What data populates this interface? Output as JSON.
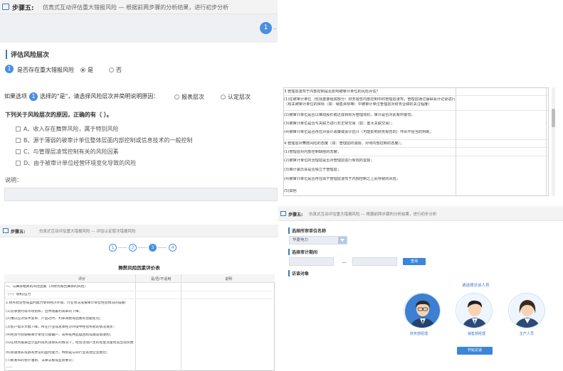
{
  "panelA": {
    "step_label": "步骤五:",
    "header_text": "仿真式互动评估重大错报风险 — 根据前两步骤的分析结果，进行初步分析",
    "current_step": "1",
    "step_more": "...",
    "section_title": "评估风险层次",
    "q1_num": "1",
    "q1_text": "是否存在重大错报风险",
    "q1_opt_yes": "是",
    "q1_opt_no": "否",
    "q2_prefix": "如果选项",
    "q2_num": "1",
    "q2_text": "选择的\"是\"，请选择风险层次并简明说明原因：",
    "q2_opt1": "报表层次",
    "q2_opt2": "认定层次",
    "mc_question": "下列关于风险层次的原因，正确的有（ ）。",
    "choices": [
      "A、收入存在舞弊风险，属于特别风险",
      "B、源于薄弱的被审计单位整体层面内部控制或信息技术的一般控制",
      "C、与管理层凌驾控制有关的风险因素",
      "D、由于被审计单位经营环境变化导致的风险"
    ],
    "explain_label": "说明："
  },
  "panelB": {
    "rows": [
      "3.管理层凌驾于内部控制是否影响被审计单位的风险评估？",
      "(1)在被审计单位（包括重要组成部分）财务报告内部控制中的管理层凌驾，管理层通过操纵会计记录进行舞弊；",
      "（有关被审计单位的目标（如：销售目标等）中被审计单位管理层对财务业绩的关注程度）",
      "(2)被审计单位是否以推动股价或达成目标为管理动机，审计是否对此有所警觉；",
      "(3)被审计单位是否与关联方进行非正常交易（如：重大关联交易）；",
      "(4)被审计单位是否存在对会计政策或会计估计（可能影响财务报告的）作出不恰当的判断；",
      "4.管理层对舞弊风险的态度（如：管理层的诚信、对待内部控制的态度）；",
      "(1)管理层对内部控制缺陷的态度；",
      "(2)被审计单位的治理层是否对管理层进行有效的监督；",
      "(3)审计委员会是否独立于管理层；",
      "(4)被审计单位是否存在由于管理层凌驾于内部控制之上而导致的风险；",
      "(5)其他"
    ]
  },
  "panelC": {
    "step_label": "步骤五:",
    "header_text": "仿真式互动评估重大错报风险 — 评估认定层次错报风险",
    "steps": [
      "1",
      "2",
      "3",
      "4"
    ],
    "active_step": "3",
    "table_title": "舞弊风险因素评价表",
    "col_headers": [
      "评价",
      "是/否/不适用",
      "说明"
    ],
    "rows": [
      "一、与舞弊相关的风险因素（对财务报告舞弊的风险）",
      "（一）动机/压力",
      "1.财务稳定性或盈利能力受到经济环境、行业状况或被审计单位经营情况的威胁：",
      "(1)竞争激烈或市场饱和，且伴随着利润率的下降；",
      "(2)难以应对技术变革、产品过时、利率调整等因素的急剧变化；",
      "(3)客户需求大幅下降，所在行业或总体经济环境中经营失败的情况增多；",
      "(4)经营亏损使被审计单位可能破产、丧失抵押品赎回权或遭恶意收购；",
      "(5)在财务报表显示盈利或利润增长的情况下，经营活动产生的现金流量经常出现负数；",
      "(6)高速增长或具有异常的盈利能力，特别是与同行业其他企业相比；",
      "(7)新发布的会计准则、法律法规或监管要求；",
      "……"
    ]
  },
  "panelD": {
    "step_label": "步骤五:",
    "header_text": "仿真式互动评估重大错报风险 — 根据前两步骤的分析结果，进行初步分析",
    "label_company": "选择所审单位名称",
    "company_value": "华夏电力",
    "label_period": "选择审计期间",
    "query_btn": "查询",
    "label_interview": "访谈对象",
    "interview_link": "请选择访谈人员",
    "people": [
      "财务部经理",
      "销售部经理",
      "生产人员"
    ],
    "start_btn": "开始访谈"
  }
}
